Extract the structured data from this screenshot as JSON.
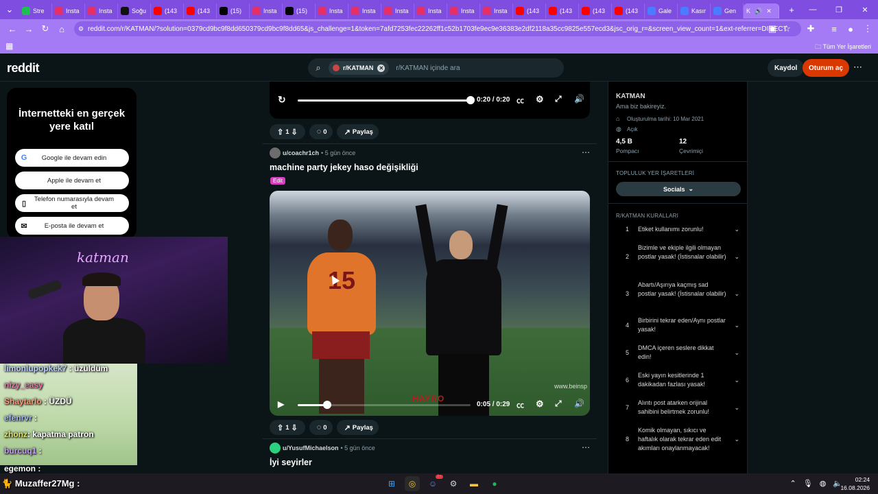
{
  "browser": {
    "tabs": [
      {
        "label": "Stre",
        "color": "#1fbf55"
      },
      {
        "label": "Insta",
        "color": "#e1306c"
      },
      {
        "label": "Insta",
        "color": "#e1306c"
      },
      {
        "label": "Soğu",
        "color": "#111111"
      },
      {
        "label": "(143",
        "color": "#ff0000"
      },
      {
        "label": "(143",
        "color": "#ff0000"
      },
      {
        "label": "(15)",
        "color": "#000000"
      },
      {
        "label": "Insta",
        "color": "#e1306c"
      },
      {
        "label": "(15)",
        "color": "#000000"
      },
      {
        "label": "Insta",
        "color": "#e1306c"
      },
      {
        "label": "Insta",
        "color": "#e1306c"
      },
      {
        "label": "Insta",
        "color": "#e1306c"
      },
      {
        "label": "Insta",
        "color": "#e1306c"
      },
      {
        "label": "Insta",
        "color": "#e1306c"
      },
      {
        "label": "Insta",
        "color": "#e1306c"
      },
      {
        "label": "(143",
        "color": "#ff0000"
      },
      {
        "label": "(143",
        "color": "#ff0000"
      },
      {
        "label": "(143",
        "color": "#ff0000"
      },
      {
        "label": "(143",
        "color": "#ff0000"
      },
      {
        "label": "Gale",
        "color": "#4a7cff"
      },
      {
        "label": "Kasır",
        "color": "#4a7cff"
      },
      {
        "label": "Gen",
        "color": "#4a7cff"
      }
    ],
    "active_tab": "K",
    "url": "reddit.com/r/KATMAN/?solution=0379cd9bc9f8dd650379cd9bc9f8dd65&js_challenge=1&token=7afd7253fec22262ff1c52b1703fe9ec9e36383e2df2118a35cc9825e557ecd3&jsc_orig_r=&screen_view_count=1&ext-referrer=DIRECT",
    "all_bookmarks": "Tüm Yer İşaretleri"
  },
  "header": {
    "logo": "reddit",
    "search_chip": "r/KATMAN",
    "search_placeholder": "r/KATMAN içinde ara",
    "signup": "Kaydol",
    "login": "Oturum aç"
  },
  "login_card": {
    "title": "İnternetteki en gerçek yere katıl",
    "buttons": [
      "Google ile devam edin",
      "Apple ile devam et",
      "Telefon numarasıyla devam et",
      "E-posta ile devam et"
    ]
  },
  "stream_overlay": {
    "neon_text": "katman",
    "chat": [
      {
        "user": "limonlupopkek7",
        "msg": " : üzüldüm"
      },
      {
        "user": "nizy_easy",
        "msg": ""
      },
      {
        "user": "Shaytarlo",
        "msg": " : ÜZDÜ"
      },
      {
        "user": "efenrvr",
        "msg": " :"
      },
      {
        "user": "zhonz",
        "msg": ": kapatma patron"
      },
      {
        "user": "burcuq1",
        "msg": " :"
      },
      {
        "user": "egemon",
        "msg": " :"
      }
    ]
  },
  "feed": {
    "post1": {
      "time": "0:20 / 0:20",
      "votes": "1",
      "comments": "0",
      "share": "Paylaş",
      "progress": 1.0
    },
    "post2": {
      "author": "u/coachr1ch",
      "age": "5 gün önce",
      "title": "machine party jekey haso değişikliği",
      "flair": "Edit",
      "time": "0:05 / 0:29",
      "votes": "1",
      "comments": "0",
      "share": "Paylaş",
      "progress": 0.17,
      "jersey_number": "15",
      "watermark": "HAYRO",
      "broadcaster": "www.beinsp"
    },
    "post3": {
      "author": "u/YusufMichaelson",
      "age": "5 gün önce",
      "title": "İyi seyirler"
    }
  },
  "sidebar": {
    "name": "KATMAN",
    "description": "Ama biz bakireyiz.",
    "created": "Oluşturulma tarihi: 10 Mar 2021",
    "visibility": "Açık",
    "members_value": "4,5 B",
    "members_label": "Pompacı",
    "online_value": "12",
    "online_label": "Çevrimiçi",
    "bookmarks_head": "TOPLULUK YER İŞARETLERİ",
    "socials": "Socials",
    "rules_head": "R/KATMAN KURALLARI",
    "rules": [
      {
        "n": "1",
        "t": "Etiket kullanımı zorunlu!"
      },
      {
        "n": "2",
        "t": "Bizimle ve ekiple ilgili olmayan postlar yasak! (İstisnalar olabilir)"
      },
      {
        "n": "3",
        "t": "Abartı/Aşırıya kaçmış sad postlar yasak! (İstisnalar olabilir)"
      },
      {
        "n": "4",
        "t": "Birbirini tekrar eden/Aynı postlar yasak!"
      },
      {
        "n": "5",
        "t": "DMCA içeren seslere dikkat edin!"
      },
      {
        "n": "6",
        "t": "Eski yayın kesitlerinde 1 dakikadan fazlası yasak!"
      },
      {
        "n": "7",
        "t": "Alıntı post atarken orijinal sahibini belirtmek zorunlu!"
      },
      {
        "n": "8",
        "t": "Komik olmayan, sıkıcı ve haftalık olarak tekrar eden edit akımları onaylanmayacak!"
      }
    ]
  },
  "taskbar": {
    "overlay_user": "Muzaffer27Mg :",
    "time": "02:24",
    "date": "16.08.2026",
    "discord_badge": "9+"
  }
}
